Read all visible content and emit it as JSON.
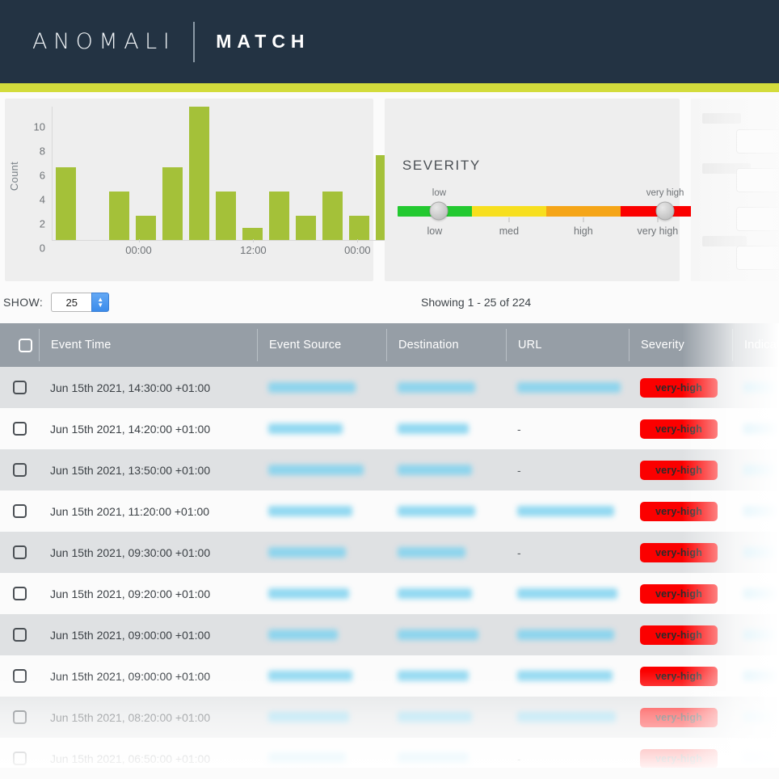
{
  "brand": {
    "product": "ANOMALI",
    "suite": "MATCH",
    "navy": "#233343",
    "accent": "#d3dc3c"
  },
  "chart_data": {
    "type": "bar",
    "title": "",
    "xlabel": "",
    "ylabel": "Count",
    "ylim": [
      0,
      11
    ],
    "yticks": [
      0,
      2,
      4,
      6,
      8,
      10
    ],
    "grid": false,
    "bar_color": "#a4c139",
    "categories": [
      "",
      "",
      "",
      "",
      "",
      "",
      "",
      "",
      "",
      "",
      "",
      "",
      ""
    ],
    "values": [
      6,
      0,
      4,
      2,
      6,
      11,
      4,
      1,
      4,
      2,
      4,
      2,
      7
    ],
    "xtick_labels": [
      "00:00",
      "12:00",
      "00:00"
    ],
    "xtick_positions_pct": [
      25,
      58,
      88
    ]
  },
  "severity": {
    "title": "SEVERITY",
    "segments": [
      {
        "label": "low",
        "color": "#23c930"
      },
      {
        "label": "med",
        "color": "#f7df1f"
      },
      {
        "label": "high",
        "color": "#f5a518"
      },
      {
        "label": "very high",
        "color": "#fb0000"
      }
    ],
    "scale_labels": [
      "low",
      "med",
      "high",
      "very high"
    ],
    "handles": [
      {
        "label": "low",
        "position_pct": 14
      },
      {
        "label": "very high",
        "position_pct": 90
      }
    ]
  },
  "toolbar": {
    "show_label": "SHOW:",
    "show_value": "25",
    "showing_text": "Showing 1 - 25 of 224"
  },
  "table": {
    "columns": [
      "",
      "Event Time",
      "Event Source",
      "Destination",
      "URL",
      "Severity",
      "Indicator"
    ],
    "rows": [
      {
        "time": "Jun 15th 2021, 14:30:00 +01:00",
        "source": "redacted",
        "destination": "redacted",
        "url": "redacted",
        "severity": "very-high",
        "indicator": "redacted"
      },
      {
        "time": "Jun 15th 2021, 14:20:00 +01:00",
        "source": "redacted",
        "destination": "redacted",
        "url": "-",
        "severity": "very-high",
        "indicator": "redacted"
      },
      {
        "time": "Jun 15th 2021, 13:50:00 +01:00",
        "source": "redacted",
        "destination": "redacted",
        "url": "-",
        "severity": "very-high",
        "indicator": "redacted"
      },
      {
        "time": "Jun 15th 2021, 11:20:00 +01:00",
        "source": "redacted",
        "destination": "redacted",
        "url": "redacted",
        "severity": "very-high",
        "indicator": "redacted"
      },
      {
        "time": "Jun 15th 2021, 09:30:00 +01:00",
        "source": "redacted",
        "destination": "redacted",
        "url": "-",
        "severity": "very-high",
        "indicator": "redacted"
      },
      {
        "time": "Jun 15th 2021, 09:20:00 +01:00",
        "source": "redacted",
        "destination": "redacted",
        "url": "redacted",
        "severity": "very-high",
        "indicator": "redacted"
      },
      {
        "time": "Jun 15th 2021, 09:00:00 +01:00",
        "source": "redacted",
        "destination": "redacted",
        "url": "redacted",
        "severity": "very-high",
        "indicator": "redacted"
      },
      {
        "time": "Jun 15th 2021, 09:00:00 +01:00",
        "source": "redacted",
        "destination": "redacted",
        "url": "redacted",
        "severity": "very-high",
        "indicator": "redacted"
      },
      {
        "time": "Jun 15th 2021, 08:20:00 +01:00",
        "source": "redacted",
        "destination": "redacted",
        "url": "redacted",
        "severity": "very-high",
        "indicator": "redacted"
      },
      {
        "time": "Jun 15th 2021, 06:50:00 +01:00",
        "source": "redacted",
        "destination": "redacted",
        "url": "-",
        "severity": "very-high",
        "indicator": "redacted"
      }
    ]
  }
}
